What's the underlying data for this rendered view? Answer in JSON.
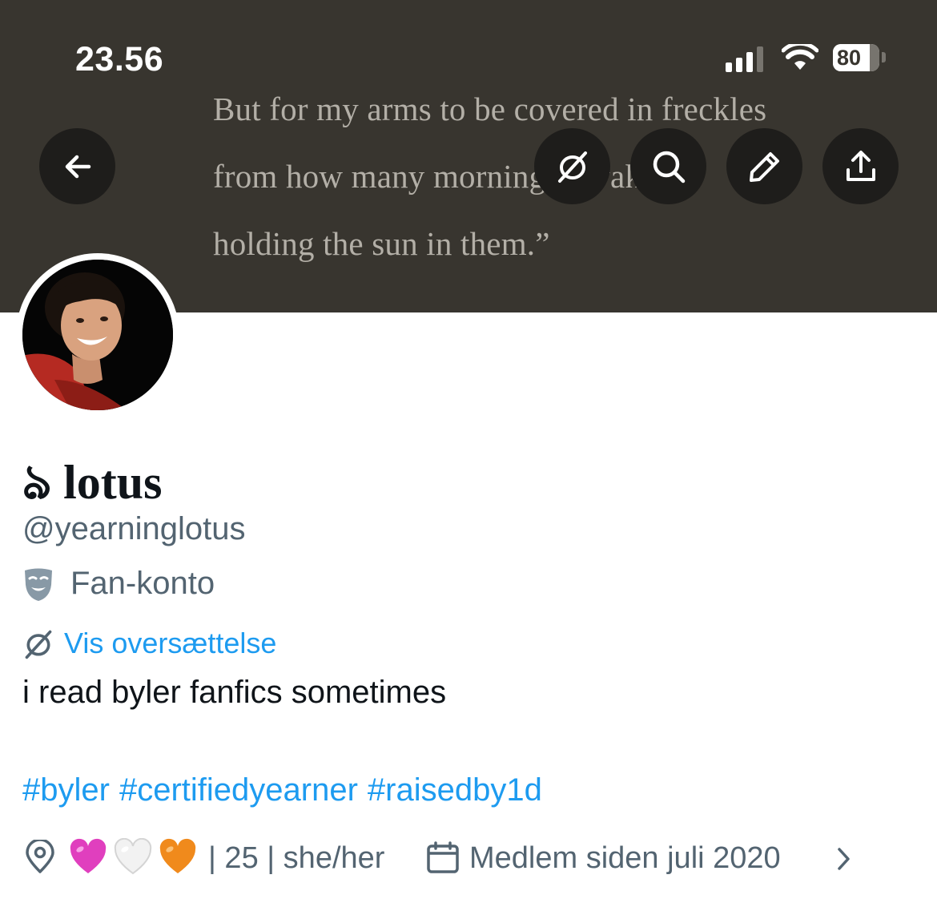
{
  "status_bar": {
    "time": "23.56",
    "battery": "80",
    "battery_level": 0.8
  },
  "banner": {
    "lines": [
      "But for my arms to be covered in freckles",
      "from how many mornings I wake up",
      "holding the sun in them.”"
    ]
  },
  "toolbar": {
    "back_icon": "arrow-left-icon",
    "buttons": [
      "translate-icon",
      "search-icon",
      "edit-icon",
      "share-icon"
    ]
  },
  "profile": {
    "name_glyph": "ঌ",
    "name": "lotus",
    "handle": "@yearninglotus",
    "label": "Fan-konto",
    "translate": "Vis oversættelse",
    "bio": "i read byler fanfics sometimes",
    "hashtags": [
      "#byler",
      "#certifiedyearner",
      "#raisedby1d"
    ],
    "location": "| 25 | she/her",
    "joined": "Medlem siden juli 2020"
  },
  "colors": {
    "banner_bg": "#38352f",
    "link": "#1d9bf0",
    "secondary_text": "#536471",
    "primary_text": "#0f1419"
  }
}
